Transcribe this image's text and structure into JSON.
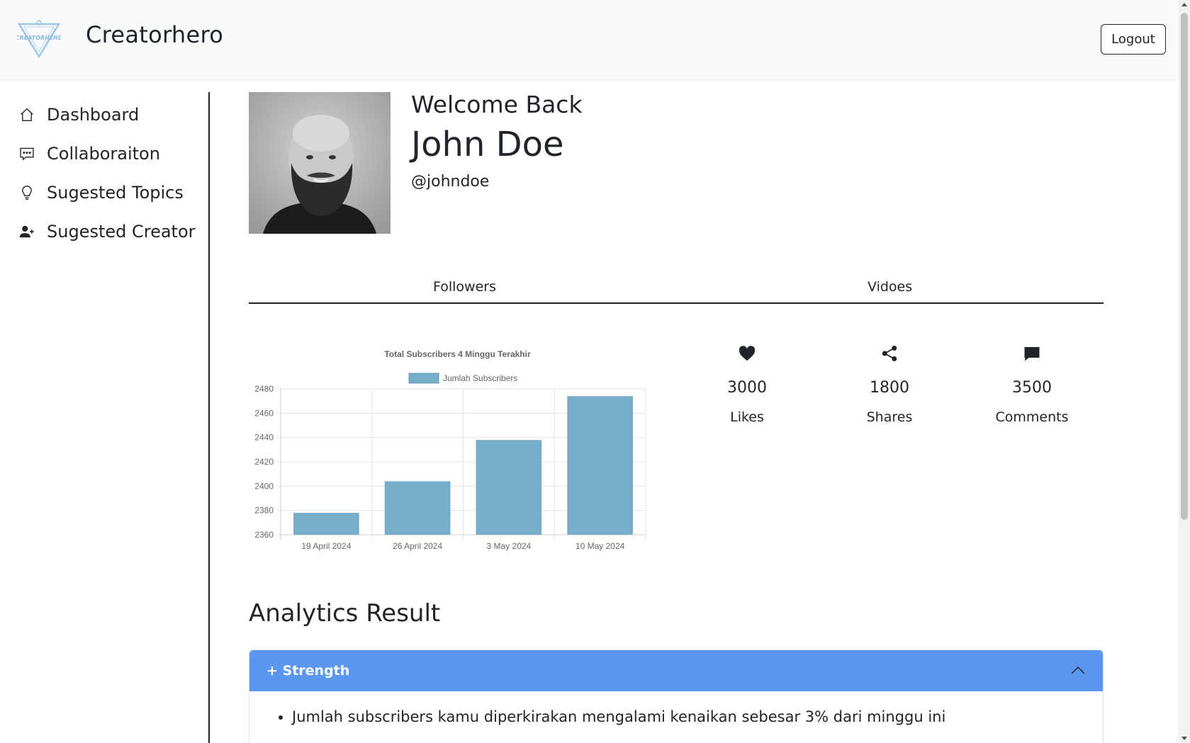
{
  "header": {
    "logo_text": "CREATORHERO",
    "brand": "Creatorhero",
    "logout_label": "Logout"
  },
  "sidebar": {
    "items": [
      {
        "label": "Dashboard",
        "icon": "house-icon"
      },
      {
        "label": "Collaboraiton",
        "icon": "chat-dots-icon"
      },
      {
        "label": "Sugested Topics",
        "icon": "lightbulb-icon"
      },
      {
        "label": "Sugested Creator",
        "icon": "person-add-icon"
      }
    ]
  },
  "profile": {
    "welcome": "Welcome Back",
    "name": "John Doe",
    "handle": "@johndoe"
  },
  "tabs": [
    {
      "label": "Followers"
    },
    {
      "label": "Vidoes"
    }
  ],
  "chart_data": {
    "type": "bar",
    "title": "Total Subscribers 4 Minggu Terakhir",
    "categories": [
      "19 April 2024",
      "26 April 2024",
      "3 May 2024",
      "10 May 2024"
    ],
    "series": [
      {
        "name": "Jumlah Subscribers",
        "values": [
          2378,
          2404,
          2438,
          2474
        ]
      }
    ],
    "ylim": [
      2360,
      2480
    ],
    "yticks": [
      2360,
      2380,
      2400,
      2420,
      2440,
      2460,
      2480
    ],
    "grid": true,
    "legend": "top",
    "bar_color": "#78adc9",
    "bar_border": "#5f9bbb"
  },
  "stats": [
    {
      "value": "3000",
      "label": "Likes",
      "icon": "heart-icon"
    },
    {
      "value": "1800",
      "label": "Shares",
      "icon": "share-icon"
    },
    {
      "value": "3500",
      "label": "Comments",
      "icon": "chat-icon"
    }
  ],
  "analytics": {
    "title": "Analytics Result",
    "accordion_title": "+ Strength",
    "accordion_color": "#5b97f0",
    "items": [
      "Jumlah subscribers kamu diperkirakan mengalami kenaikan sebesar 3% dari minggu ini"
    ]
  }
}
